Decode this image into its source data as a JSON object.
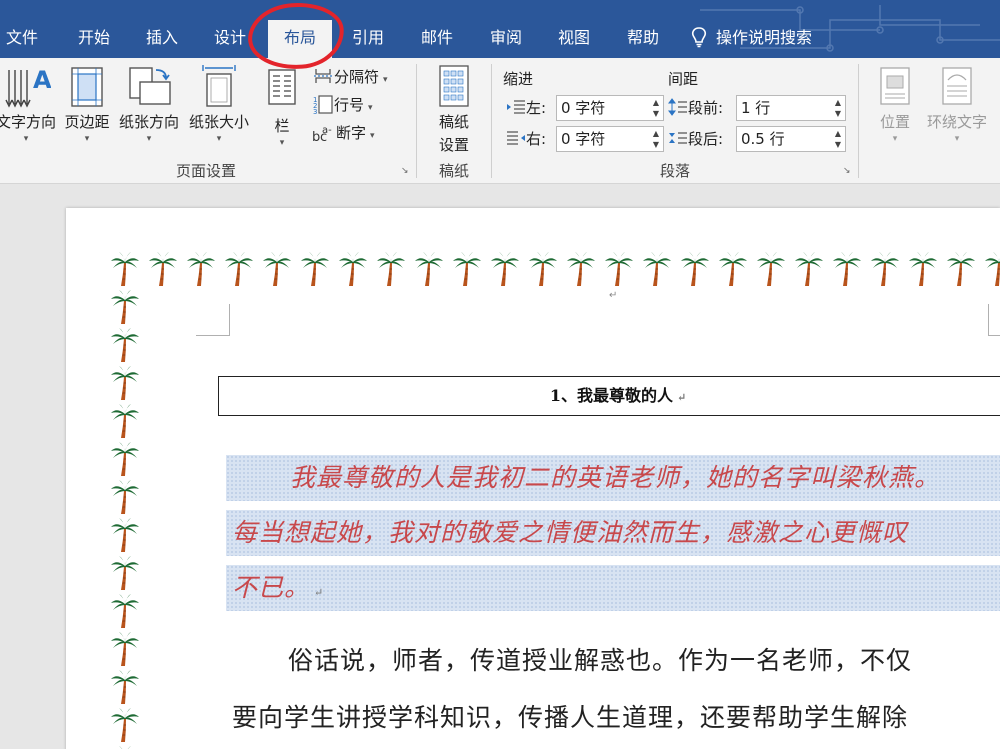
{
  "tabs": [
    {
      "label": "文件"
    },
    {
      "label": "开始"
    },
    {
      "label": "插入"
    },
    {
      "label": "设计"
    },
    {
      "label": "布局"
    },
    {
      "label": "引用"
    },
    {
      "label": "邮件"
    },
    {
      "label": "审阅"
    },
    {
      "label": "视图"
    },
    {
      "label": "帮助"
    }
  ],
  "search": {
    "label": "操作说明搜索"
  },
  "ribbon": {
    "page_setup": {
      "text_direction": "文字方向",
      "margins": "页边距",
      "orientation": "纸张方向",
      "size": "纸张大小",
      "columns": "栏",
      "breaks": "分隔符",
      "line_numbers": "行号",
      "hyphenation": "断字",
      "group_label": "页面设置"
    },
    "manuscript": {
      "button_line1": "稿纸",
      "button_line2": "设置",
      "group_label": "稿纸"
    },
    "paragraph": {
      "indent_title": "缩进",
      "spacing_title": "间距",
      "left_label": "左:",
      "left_value": "0 字符",
      "right_label": "右:",
      "right_value": "0 字符",
      "before_label": "段前:",
      "before_value": "1 行",
      "after_label": "段后:",
      "after_value": "0.5 行",
      "group_label": "段落"
    },
    "arrange": {
      "position": "位置",
      "wrap_text": "环绕文字"
    }
  },
  "document": {
    "title": "1、我最尊敬的人",
    "highlight_lines": [
      "我最尊敬的人是我初二的英语老师，她的名字叫梁秋燕。",
      "每当想起她，我对的敬爱之情便油然而生，感激之心更慨叹",
      "不已。"
    ],
    "body_lines": [
      "俗话说，师者，传道授业解惑也。作为一名老师，不仅",
      "要向学生讲授学科知识，传播人生道理，还要帮助学生解除"
    ],
    "paragraph_mark": "↵"
  },
  "colors": {
    "accent": "#2b579a",
    "highlight_text": "#c8484b",
    "annotation": "#e3242b"
  }
}
